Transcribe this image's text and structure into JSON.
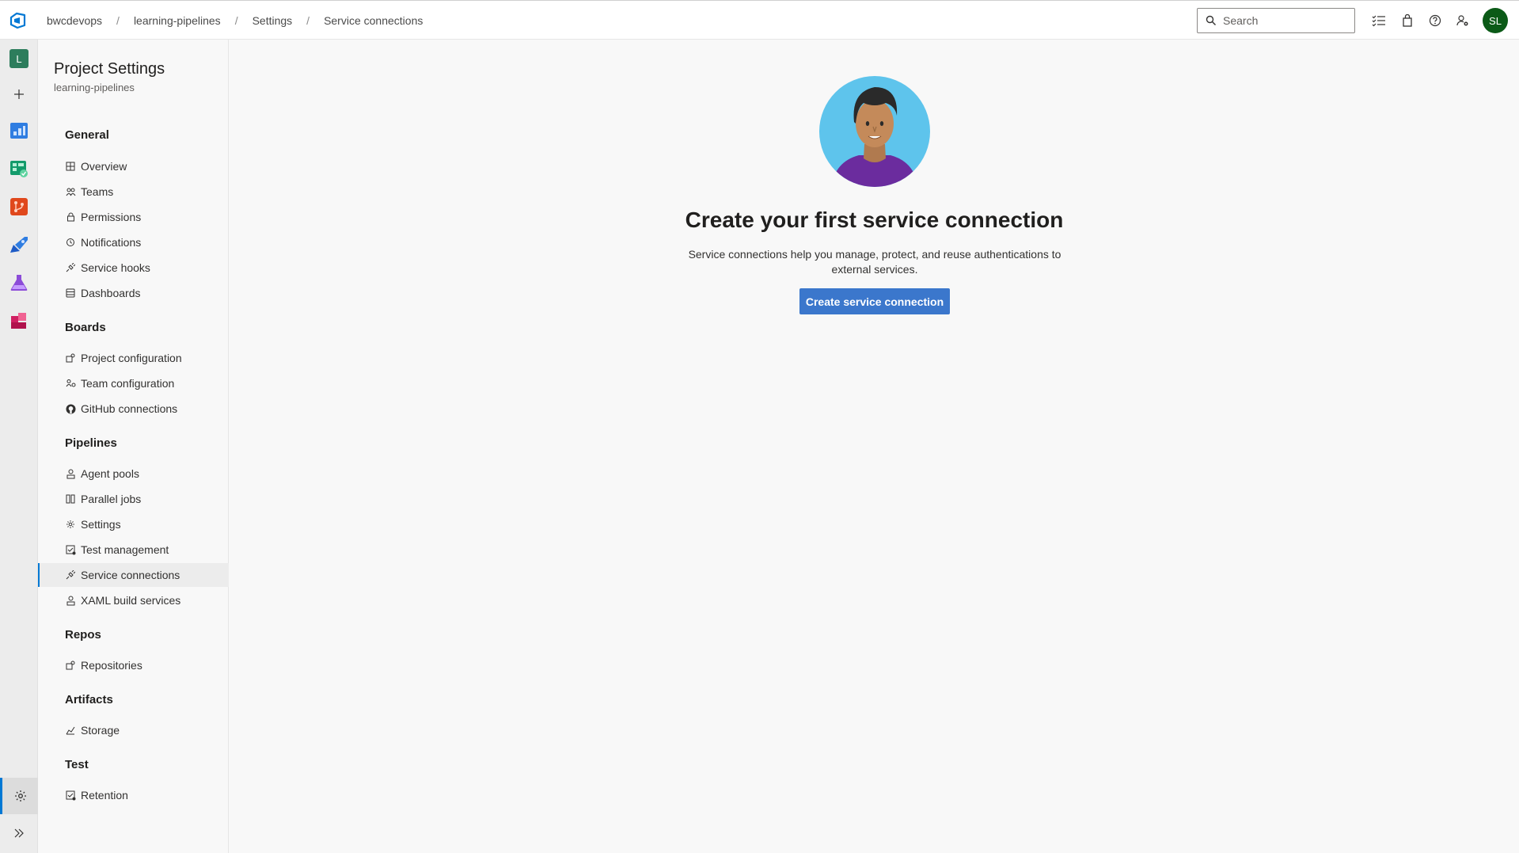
{
  "breadcrumb": {
    "items": [
      "bwcdevops",
      "learning-pipelines",
      "Settings",
      "Service connections"
    ],
    "separator": "/"
  },
  "search": {
    "placeholder": "Search"
  },
  "user": {
    "initials": "SL"
  },
  "rail": {
    "project_initial": "L"
  },
  "settings_nav": {
    "title": "Project Settings",
    "subtitle": "learning-pipelines",
    "groups": [
      {
        "header": "General",
        "items": [
          "Overview",
          "Teams",
          "Permissions",
          "Notifications",
          "Service hooks",
          "Dashboards"
        ]
      },
      {
        "header": "Boards",
        "items": [
          "Project configuration",
          "Team configuration",
          "GitHub connections"
        ]
      },
      {
        "header": "Pipelines",
        "items": [
          "Agent pools",
          "Parallel jobs",
          "Settings",
          "Test management",
          "Service connections",
          "XAML build services"
        ]
      },
      {
        "header": "Repos",
        "items": [
          "Repositories"
        ]
      },
      {
        "header": "Artifacts",
        "items": [
          "Storage"
        ]
      },
      {
        "header": "Test",
        "items": [
          "Retention"
        ]
      }
    ],
    "selected": "Service connections"
  },
  "main": {
    "title": "Create your first service connection",
    "description": "Service connections help you manage, protect, and reuse authentications to external services.",
    "button_label": "Create service connection"
  },
  "colors": {
    "accent": "#0078d4",
    "button": "#3b77cc",
    "avatar": "#0b5a17",
    "project_badge": "#2d7d5c"
  }
}
